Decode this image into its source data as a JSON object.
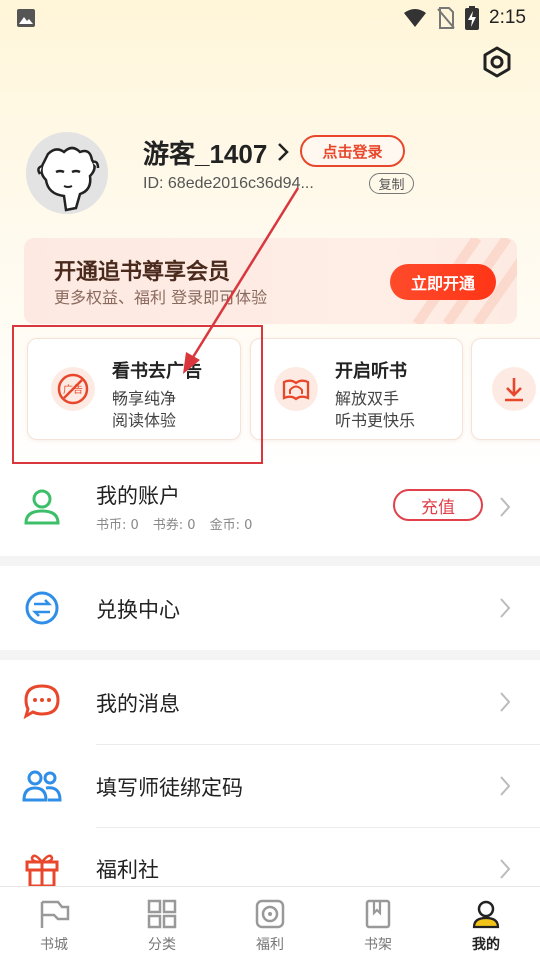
{
  "status_bar": {
    "time": "2:15",
    "icons": [
      "image-icon",
      "wifi-icon",
      "no-sim-icon",
      "battery-charging-icon"
    ]
  },
  "header": {
    "settings_icon": "settings-icon"
  },
  "profile": {
    "username": "游客_1407",
    "login_label": "点击登录",
    "user_id": "ID: 68ede2016c36d94...",
    "copy_label": "复制"
  },
  "vip_banner": {
    "title": "开通追书尊享会员",
    "subtitle": "更多权益、福利 登录即可体验",
    "button_label": "立即开通"
  },
  "feature_cards": [
    {
      "title": "看书去广告",
      "line1": "畅享纯净",
      "line2": "阅读体验",
      "icon": "no-ads-icon"
    },
    {
      "title": "开启听书",
      "line1": "解放双手",
      "line2": "听书更快乐",
      "icon": "audiobook-icon"
    },
    {
      "title": "",
      "line1": "",
      "line2": "",
      "icon": "download-icon"
    }
  ],
  "account": {
    "title": "我的账户",
    "stats": [
      "书币: 0",
      "书券: 0",
      "金币: 0"
    ],
    "recharge_label": "充值"
  },
  "menu": {
    "exchange": "兑换中心",
    "messages": "我的消息",
    "invite_code": "填写师徒绑定码",
    "welfare_club": "福利社"
  },
  "bottom_nav": [
    {
      "label": "书城",
      "icon": "bookstore-icon",
      "active": false
    },
    {
      "label": "分类",
      "icon": "category-icon",
      "active": false
    },
    {
      "label": "福利",
      "icon": "welfare-icon",
      "active": false
    },
    {
      "label": "书架",
      "icon": "bookshelf-icon",
      "active": false
    },
    {
      "label": "我的",
      "icon": "profile-icon",
      "active": true
    }
  ],
  "colors": {
    "accent": "#e8472c",
    "annotation": "#d9363e",
    "green": "#3dbf6a",
    "blue": "#2f8fe8"
  }
}
